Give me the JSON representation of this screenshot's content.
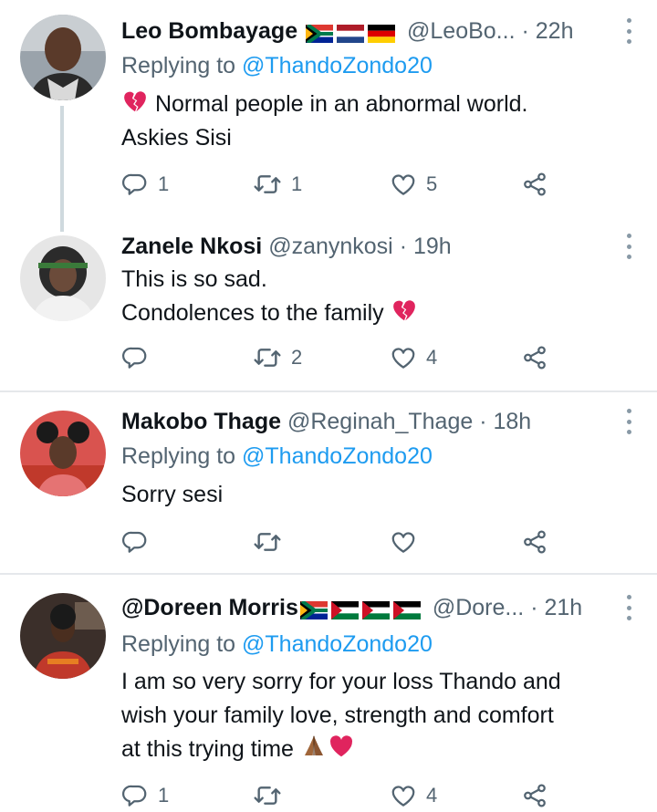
{
  "tweets": [
    {
      "name": "Leo Bombayage",
      "handle": "@LeoBo...",
      "time": "· 22h",
      "replying_prefix": "Replying to",
      "replying_to": "@ThandoZondo20",
      "text_line1": "Normal people in an abnormal world.",
      "text_line2": "Askies Sisi",
      "flags": [
        "south-africa-flag",
        "netherlands-flag",
        "germany-flag"
      ],
      "emoji_line1": "broken-heart-icon",
      "reply_count": "1",
      "retweet_count": "1",
      "like_count": "5"
    },
    {
      "name": "Zanele Nkosi",
      "handle": "@zanynkosi",
      "time": "· 19h",
      "text_line1": "This is so sad.",
      "text_line2": "Condolences to the family",
      "emoji_line2": "broken-heart-icon",
      "reply_count": "",
      "retweet_count": "2",
      "like_count": "4"
    },
    {
      "name": "Makobo Thage",
      "handle": "@Reginah_Thage",
      "time": "· 18h",
      "replying_prefix": "Replying to",
      "replying_to": "@ThandoZondo20",
      "text_line1": "Sorry sesi",
      "reply_count": "",
      "retweet_count": "",
      "like_count": ""
    },
    {
      "name": "@Doreen Morris",
      "handle": "@Dore...",
      "time": "· 21h",
      "replying_prefix": "Replying to",
      "replying_to": "@ThandoZondo20",
      "text_line1": "I am so very sorry for your loss Thando and",
      "text_line2": "wish your family love, strength and comfort",
      "text_line3": "at this trying time",
      "flags": [
        "south-africa-flag",
        "palestine-flag",
        "palestine-flag",
        "palestine-flag"
      ],
      "emoji_line3": [
        "folded-hands-icon",
        "red-heart-icon"
      ],
      "reply_count": "1",
      "retweet_count": "",
      "like_count": "4"
    }
  ],
  "colors": {
    "text": "#0f1419",
    "secondary": "#536471",
    "link": "#1d9bf0",
    "divider": "#e5e8eb",
    "heart": "#e0245e"
  }
}
